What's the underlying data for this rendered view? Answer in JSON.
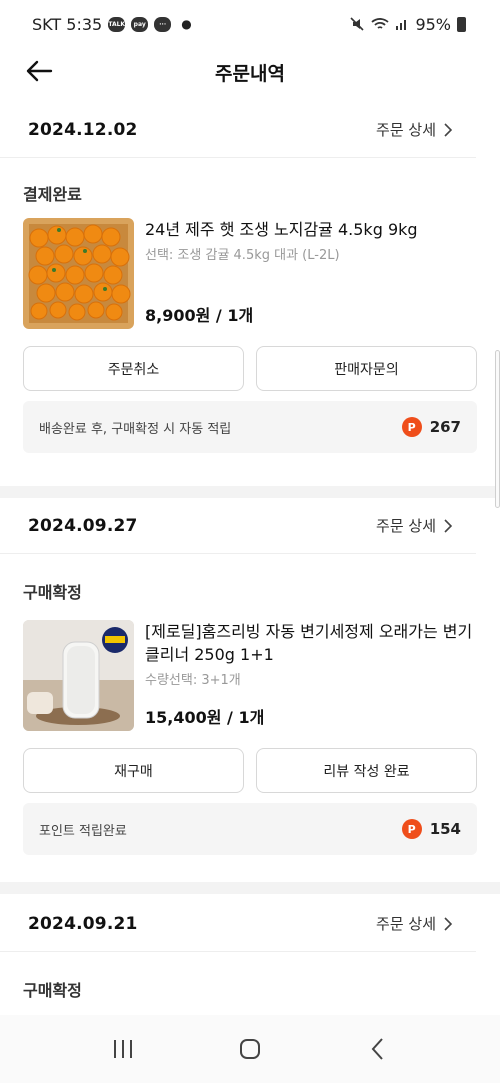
{
  "status_bar": {
    "carrier_time": "SKT 5:35",
    "icon1": "TALK",
    "icon2": "pay",
    "battery": "95%"
  },
  "header": {
    "title": "주문내역"
  },
  "orders": [
    {
      "date": "2024.12.02",
      "detail_label": "주문 상세",
      "status": "결제완료",
      "product_name": "24년 제주 햇 조생 노지감귤 4.5kg 9kg",
      "product_option": "선택: 조생 감귤 4.5kg 대과 (L-2L)",
      "price": "8,900원 / 1개",
      "buttons": [
        "주문취소",
        "판매자문의"
      ],
      "points_text": "배송완료 후, 구매확정 시 자동 적립",
      "points_badge": "P",
      "points_value": "267"
    },
    {
      "date": "2024.09.27",
      "detail_label": "주문 상세",
      "status": "구매확정",
      "product_name": "[제로딜]홈즈리빙 자동 변기세정제 오래가는 변기클리너 250g 1+1",
      "product_option": "수량선택: 3+1개",
      "price": "15,400원 / 1개",
      "buttons": [
        "재구매",
        "리뷰 작성 완료"
      ],
      "points_text": "포인트 적립완료",
      "points_badge": "P",
      "points_value": "154"
    },
    {
      "date": "2024.09.21",
      "detail_label": "주문 상세",
      "status": "구매확정"
    }
  ],
  "colors": {
    "points_badge": "#ef4e1b",
    "box_bg": "#f5f5f5",
    "section_divider": "#f3f3f3"
  }
}
